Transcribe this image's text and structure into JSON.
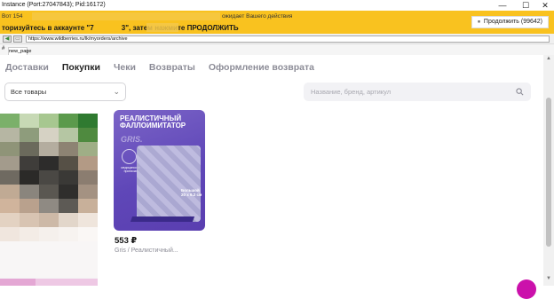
{
  "window": {
    "title": "Instance (Port:27047843); Pid:16172)",
    "controls": {
      "minimize": "—",
      "maximize": "☐",
      "close": "✕"
    }
  },
  "banner": {
    "line1_prefix": "Вот 154",
    "line1_suffix": "ожидает Вашего действия",
    "line2": "торизуйтесь в аккаунте \"7              3\", затем нажмите ПРОДОЛЖИТЬ",
    "continue_label": "Продолжить (99642)"
  },
  "address": {
    "url": "https://www.wildberries.ru/lk/myorders/archive"
  },
  "tabs_strip": {
    "star": "#",
    "tab_label": "new_page"
  },
  "nav": {
    "items": [
      {
        "label": "Доставки",
        "active": false
      },
      {
        "label": "Покупки",
        "active": true
      },
      {
        "label": "Чеки",
        "active": false
      },
      {
        "label": "Возвраты",
        "active": false
      },
      {
        "label": "Оформление возврата",
        "active": false
      }
    ]
  },
  "filter": {
    "selected": "Все товары"
  },
  "search": {
    "placeholder": "Название, бренд, артикул"
  },
  "product": {
    "image_heading": "РЕАЛИСТИЧНЫЙ\nФАЛЛОИМИТАТОР",
    "image_brand": "GRIS.",
    "image_badge": "медицинские\nпрописки",
    "image_size": "Большой\n20 x 6.2 см",
    "price": "553 ₽",
    "title": "Gris / Реалистичный..."
  },
  "colors": {
    "banner": "#f9c21f",
    "accent": "#cb11ab",
    "card_bg": "#6a50bd"
  }
}
